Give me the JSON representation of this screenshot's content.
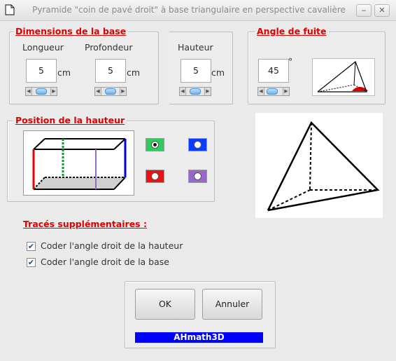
{
  "window": {
    "title": "Pyramide \"coin de pavé droit\" à base triangulaire en perspective cavalière",
    "minimize_glyph": "‒",
    "close_glyph": "✕"
  },
  "dimensions": {
    "group_title": "Dimensions de la base",
    "longueur": {
      "label": "Longueur",
      "value": "5",
      "unit": "cm"
    },
    "profondeur": {
      "label": "Profondeur",
      "value": "5",
      "unit": "cm"
    },
    "hauteur": {
      "label": "Hauteur",
      "value": "5",
      "unit": "cm"
    }
  },
  "angle": {
    "group_title": "Angle de fuite",
    "value": "45",
    "unit": "°"
  },
  "position": {
    "group_title": "Position de la hauteur",
    "options": [
      {
        "color": "#2ecc5a",
        "selected": true
      },
      {
        "color": "#0a3cff",
        "selected": false
      },
      {
        "color": "#ee1111",
        "selected": false
      },
      {
        "color": "#9966cc",
        "selected": false
      }
    ]
  },
  "traces": {
    "title": "Tracés supplémentaires :",
    "option1": {
      "label": "Coder l'angle droit de la hauteur",
      "checked": true
    },
    "option2": {
      "label": "Coder l'angle droit de la base",
      "checked": true
    }
  },
  "buttons": {
    "ok": "OK",
    "cancel": "Annuler"
  },
  "brand": "AHmath3D",
  "check_glyph": "✔"
}
